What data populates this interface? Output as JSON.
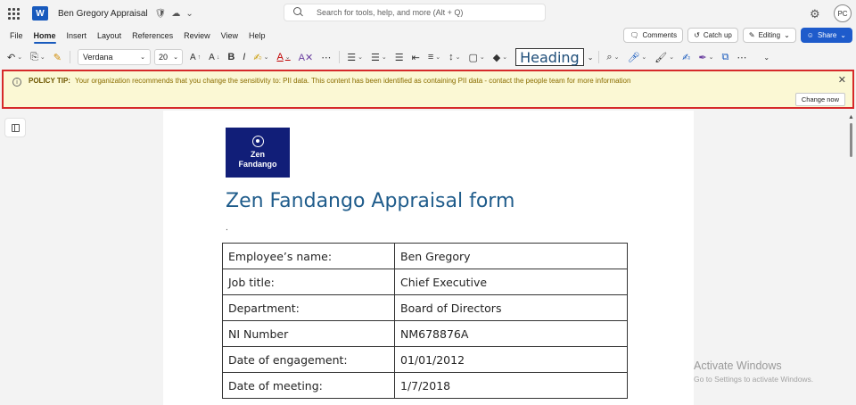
{
  "titlebar": {
    "app_initial": "W",
    "doc_title": "Ben Gregory Appraisal",
    "search_placeholder": "Search for tools, help, and more (Alt + Q)",
    "avatar_initials": "PC"
  },
  "menu": {
    "tabs": [
      "File",
      "Home",
      "Insert",
      "Layout",
      "References",
      "Review",
      "View",
      "Help"
    ],
    "active_tab": "Home",
    "comments_label": "Comments",
    "catchup_label": "Catch up",
    "editing_label": "Editing",
    "share_label": "Share"
  },
  "ribbon": {
    "font": "Verdana",
    "size": "20",
    "style": "Heading"
  },
  "policy_tip": {
    "label": "POLICY TIP:",
    "message": "Your organization recommends that you change the sensitivity to: PII data. This content has been identified as containing PII data - contact the people team for more information",
    "button": "Change now",
    "accent_color": "#d62a2a"
  },
  "document": {
    "logo_line1": "Zen",
    "logo_line2": "Fandango",
    "heading": "Zen Fandango Appraisal form",
    "dot": ".",
    "rows": [
      {
        "key": "Employee’s name:",
        "value": "Ben Gregory"
      },
      {
        "key": "Job title:",
        "value": "Chief Executive"
      },
      {
        "key": "Department:",
        "value": "Board of Directors"
      },
      {
        "key": "NI Number",
        "value": "NM678876A"
      },
      {
        "key": "Date of engagement:",
        "value": "01/01/2012"
      },
      {
        "key": "Date of meeting:",
        "value": "1/7/2018"
      }
    ]
  },
  "watermark": {
    "title": "Activate Windows",
    "subtitle": "Go to Settings to activate Windows."
  }
}
